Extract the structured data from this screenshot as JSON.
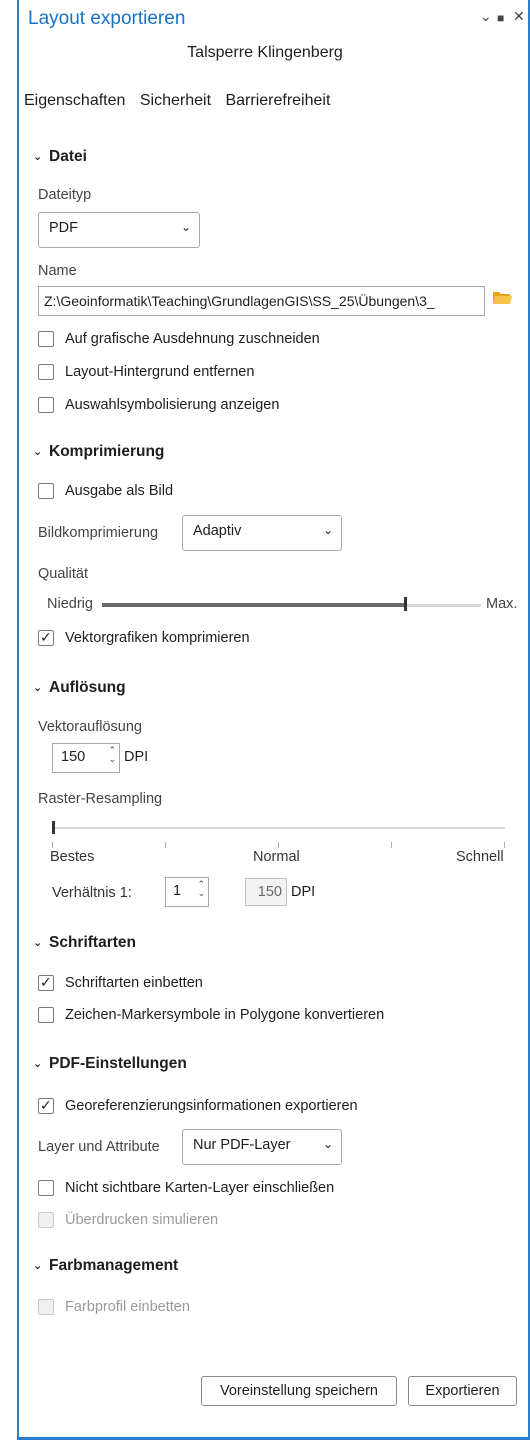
{
  "window": {
    "title": "Layout exportieren",
    "subtitle": "Talsperre Klingenberg",
    "controls": {
      "dropdown": "⌄",
      "maximize": "■",
      "close": "✕"
    }
  },
  "tabs": [
    "Eigenschaften",
    "Sicherheit",
    "Barrierefreiheit"
  ],
  "datei": {
    "header": "Datei",
    "dateityp_label": "Dateityp",
    "dateityp_value": "PDF",
    "name_label": "Name",
    "name_value": "Z:\\Geoinformatik\\Teaching\\GrundlagenGIS\\SS_25\\Übungen\\3_",
    "cb_zuschneiden": "Auf grafische Ausdehnung zuschneiden",
    "cb_hintergrund": "Layout-Hintergrund entfernen",
    "cb_auswahl": "Auswahlsymbolisierung anzeigen"
  },
  "komprimierung": {
    "header": "Komprimierung",
    "cb_bild": "Ausgabe als Bild",
    "bildkomp_label": "Bildkomprimierung",
    "bildkomp_value": "Adaptiv",
    "qualitaet_label": "Qualität",
    "qualitaet_min": "Niedrig",
    "qualitaet_max": "Max.",
    "qualitaet_level": 0.8,
    "cb_vektor": "Vektorgrafiken komprimieren"
  },
  "aufloesung": {
    "header": "Auflösung",
    "vektor_label": "Vektorauflösung",
    "vektor_value": "150",
    "dpi": "DPI",
    "raster_label": "Raster-Resampling",
    "raster_left": "Bestes",
    "raster_mid": "Normal",
    "raster_right": "Schnell",
    "raster_level": 0,
    "verhaeltnis_label": "Verhältnis 1:",
    "verhaeltnis_value": "1",
    "raster_dpi_value": "150"
  },
  "schriftarten": {
    "header": "Schriftarten",
    "cb_einbetten": "Schriftarten einbetten",
    "cb_polygone": "Zeichen-Markersymbole in Polygone konvertieren"
  },
  "pdf": {
    "header": "PDF-Einstellungen",
    "cb_georef": "Georeferenzierungsinformationen exportieren",
    "layer_label": "Layer und Attribute",
    "layer_value": "Nur PDF-Layer",
    "cb_nicht_sichtbar": "Nicht sichtbare Karten-Layer einschließen",
    "cb_ueberdrucken": "Überdrucken simulieren"
  },
  "farbmanagement": {
    "header": "Farbmanagement",
    "cb_farbprofil": "Farbprofil einbetten"
  },
  "buttons": {
    "save_preset": "Voreinstellung speichern",
    "export": "Exportieren"
  },
  "colors": {
    "accent": "#1a72c7",
    "folder": "#e8a51c"
  }
}
